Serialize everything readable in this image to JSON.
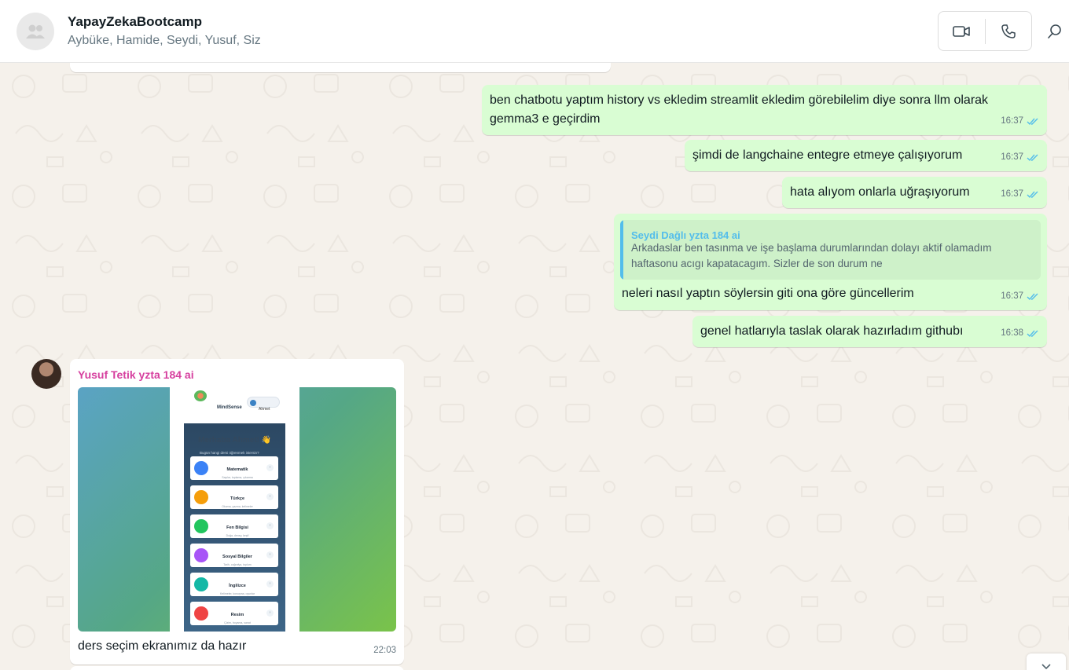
{
  "header": {
    "title": "YapayZekaBootcamp",
    "members": "Aybüke, Hamide, Seydi, Yusuf, Siz"
  },
  "icons": {
    "group_avatar": "group-avatar-icon",
    "video": "video-camera-icon",
    "call": "phone-icon",
    "search": "search-icon",
    "read": "double-check-icon"
  },
  "colors": {
    "outgoing": "#d9fdd3",
    "incoming": "#ffffff",
    "read_tick": "#53bdeb",
    "sender_name": "#d6409f",
    "quote_author": "#53bdeb"
  },
  "messages": [
    {
      "direction": "out",
      "text": "ben chatbotu yaptım history vs ekledim streamlit ekledim görebilelim diye sonra llm olarak gemma3 e geçirdim",
      "time": "16:37"
    },
    {
      "direction": "out",
      "text": "şimdi de langchaine entegre etmeye çalışıyorum",
      "time": "16:37"
    },
    {
      "direction": "out",
      "text": "hata alıyom onlarla uğraşıyorum",
      "time": "16:37"
    },
    {
      "direction": "out",
      "quote": {
        "author": "Seydi Dağlı yzta 184 ai",
        "text": "Arkadaslar ben tasınma ve işe başlama durumlarından dolayı aktif olamadım haftasonu acıgı kapatacagım. Sizler de son durum ne"
      },
      "text": "neleri nasıl yaptın söylersin giti ona göre güncellerim",
      "time": "16:37"
    },
    {
      "direction": "out",
      "text": "genel hatlarıyla taslak olarak hazırladım githubı",
      "time": "16:38"
    },
    {
      "direction": "in",
      "sender": "Yusuf Tetik yzta 184 ai",
      "caption": "ders seçim ekranımız da hazır",
      "time": "22:03",
      "image": {
        "app_name": "MindSense",
        "user_label": "Ahmet",
        "greeting": "Merhaba Ahmet! 👋",
        "greeting_sub": "Bugün hangi dersi öğrenmek istersin?",
        "subjects": [
          {
            "name": "Matematik",
            "desc": "Sayılar, toplama, çıkarma",
            "color": "#3b82f6"
          },
          {
            "name": "Türkçe",
            "desc": "Okuma, yazma, kelimeler",
            "color": "#f59e0b"
          },
          {
            "name": "Fen Bilgisi",
            "desc": "Doğa, deney, keşif",
            "color": "#22c55e"
          },
          {
            "name": "Sosyal Bilgiler",
            "desc": "Tarih, coğrafya, toplum",
            "color": "#a855f7"
          },
          {
            "name": "İngilizce",
            "desc": "Kelimeler, konuşma, oyunlar",
            "color": "#14b8a6"
          },
          {
            "name": "Resim",
            "desc": "Çizim, boyama, sanat",
            "color": "#ef4444"
          }
        ]
      }
    }
  ]
}
